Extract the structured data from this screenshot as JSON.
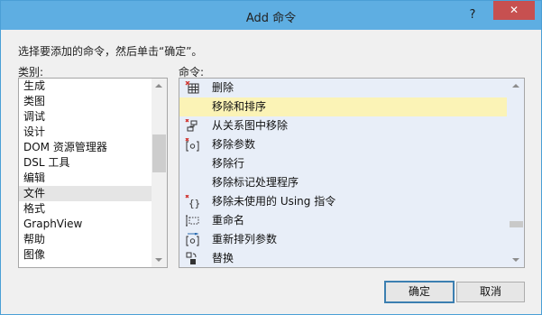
{
  "window": {
    "title": "Add 命令",
    "help": "?",
    "close": "✕"
  },
  "instruction": "选择要添加的命令，然后单击“确定”。",
  "categories": {
    "label": "类别:",
    "items": [
      "生成",
      "类图",
      "调试",
      "设计",
      "DOM 资源管理器",
      "DSL 工具",
      "编辑",
      "文件",
      "格式",
      "GraphView",
      "帮助",
      "图像"
    ],
    "selected": "文件"
  },
  "commands": {
    "label": "命令:",
    "items": [
      {
        "icon": "table-delete-icon",
        "label": "删除"
      },
      {
        "icon": "",
        "label": "移除和排序",
        "selected": true
      },
      {
        "icon": "diagram-remove-icon",
        "label": "从关系图中移除"
      },
      {
        "icon": "remove-parameter-icon",
        "label": "移除参数"
      },
      {
        "icon": "",
        "label": "移除行"
      },
      {
        "icon": "",
        "label": "移除标记处理程序"
      },
      {
        "icon": "remove-using-icon",
        "label": "移除未使用的 Using 指令"
      },
      {
        "icon": "rename-icon",
        "label": "重命名"
      },
      {
        "icon": "reorder-parameters-icon",
        "label": "重新排列参数"
      },
      {
        "icon": "replace-icon",
        "label": "替换"
      }
    ]
  },
  "buttons": {
    "ok": "确定",
    "cancel": "取消"
  }
}
